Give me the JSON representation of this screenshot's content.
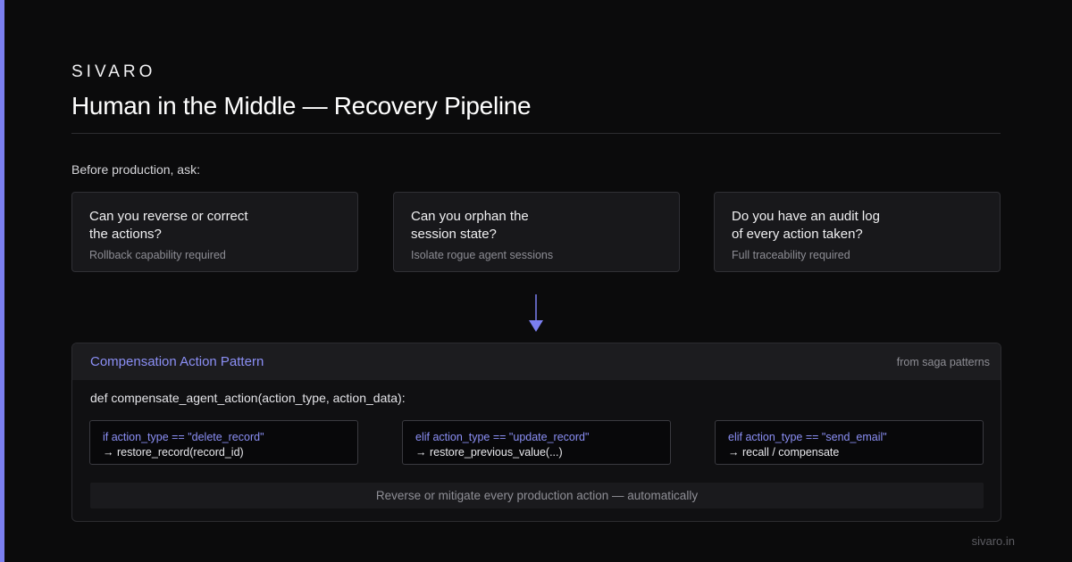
{
  "brand": "SIVARO",
  "title": "Human in the Middle — Recovery Pipeline",
  "intro": "Before production, ask:",
  "questions": [
    {
      "text": "Can you reverse or correct\nthe actions?",
      "sub": "Rollback capability required"
    },
    {
      "text": "Can you orphan the\nsession state?",
      "sub": "Isolate rogue agent sessions"
    },
    {
      "text": "Do you have an audit log\nof every action taken?",
      "sub": "Full traceability required"
    }
  ],
  "arrow_icon": "arrow-down-icon",
  "accent_color": "#7b7ff0",
  "panel": {
    "title": "Compensation Action Pattern",
    "source": "from saga patterns",
    "signature": "def compensate_agent_action(action_type, action_data):",
    "cases": [
      {
        "condition": "if action_type == \"delete_record\"",
        "action": "→ restore_record(record_id)"
      },
      {
        "condition": "elif action_type == \"update_record\"",
        "action": "→ restore_previous_value(...)"
      },
      {
        "condition": "elif action_type == \"send_email\"",
        "action": "→ recall / compensate"
      }
    ],
    "footer": "Reverse or mitigate every production action — automatically"
  },
  "site": "sivaro.in"
}
